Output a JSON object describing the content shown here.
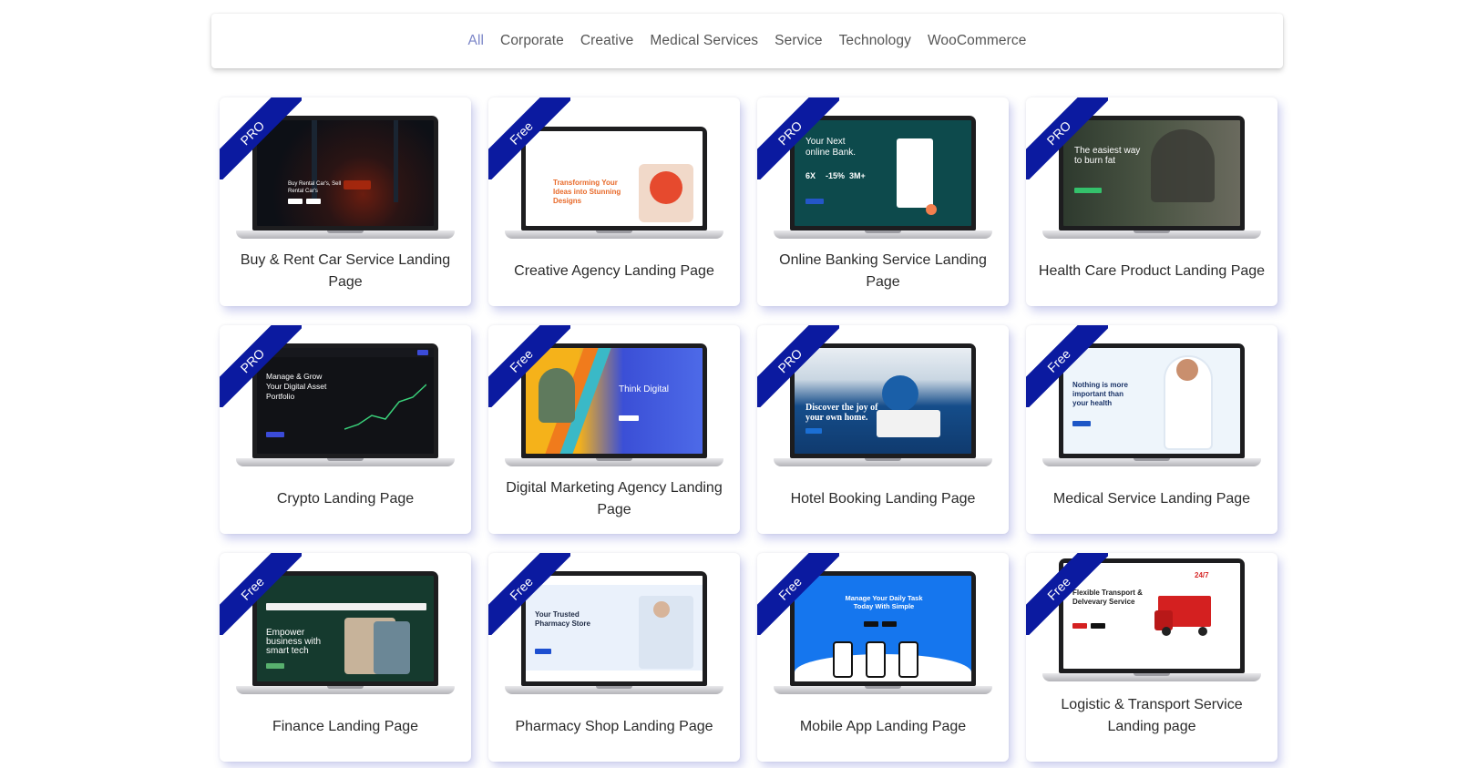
{
  "filters": [
    "All",
    "Corporate",
    "Creative",
    "Medical Services",
    "Service",
    "Technology",
    "WooCommerce"
  ],
  "active_filter": "All",
  "colors": {
    "ribbon": "#0b1aa0",
    "active_filter": "#7b85c7"
  },
  "cards": [
    {
      "badge": "PRO",
      "title": "Buy & Rent Car Service Landing Page",
      "screen": {
        "headline": "Buy Rental Car's, Sell Rental Car's"
      }
    },
    {
      "badge": "Free",
      "title": "Creative Agency Landing Page",
      "screen": {
        "headline": "Transforming Your Ideas into Stunning Designs"
      }
    },
    {
      "badge": "PRO",
      "title": "Online Banking Service Landing Page",
      "screen": {
        "headline": "Your Next online Bank.",
        "stats": [
          "6X",
          "-15%",
          "3M+"
        ]
      }
    },
    {
      "badge": "PRO",
      "title": "Health Care Product Landing Page",
      "screen": {
        "headline": "The easiest way to burn fat"
      }
    },
    {
      "badge": "PRO",
      "title": "Crypto Landing Page",
      "screen": {
        "headline": "Manage & Grow Your Digital Asset Portfolio"
      }
    },
    {
      "badge": "Free",
      "title": "Digital Marketing Agency Landing Page",
      "screen": {
        "headline": "Think Digital"
      }
    },
    {
      "badge": "PRO",
      "title": "Hotel Booking Landing Page",
      "screen": {
        "headline": "Discover the joy of your own home."
      }
    },
    {
      "badge": "Free",
      "title": "Medical Service Landing Page",
      "screen": {
        "headline": "Nothing is more important than your health"
      }
    },
    {
      "badge": "Free",
      "title": "Finance Landing Page",
      "screen": {
        "headline": "Empower business with smart tech"
      }
    },
    {
      "badge": "Free",
      "title": "Pharmacy Shop Landing Page",
      "screen": {
        "headline": "Your Trusted Pharmacy Store"
      }
    },
    {
      "badge": "Free",
      "title": "Mobile App Landing Page",
      "screen": {
        "headline": "Manage Your Daily Task Today With Simple"
      }
    },
    {
      "badge": "Free",
      "title": "Logistic & Transport Service Landing page",
      "screen": {
        "headline": "Flexible Transport & Delvevary Service",
        "tag": "24/7"
      }
    }
  ]
}
